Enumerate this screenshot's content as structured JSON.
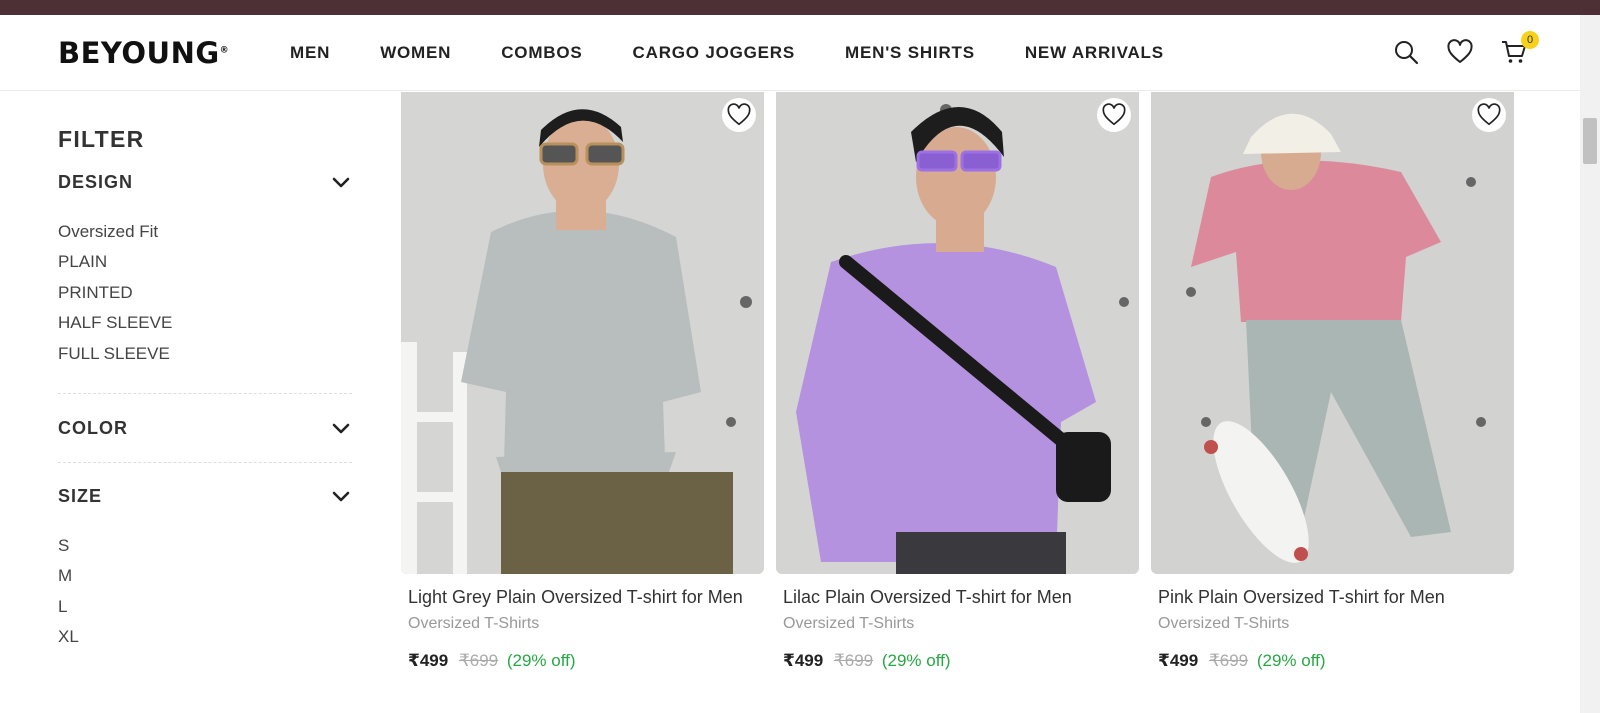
{
  "brand": {
    "logo": "BEYOUNG",
    "mark": "®",
    "topbar_color": "#4d2f36"
  },
  "nav": [
    "MEN",
    "WOMEN",
    "COMBOS",
    "CARGO JOGGERS",
    "MEN'S SHIRTS",
    "NEW ARRIVALS"
  ],
  "header_icons": {
    "search": "search-icon",
    "wishlist": "heart-icon",
    "cart": "cart-icon",
    "cart_count": "0"
  },
  "sidebar": {
    "title": "FILTER",
    "design": {
      "label": "DESIGN",
      "options": [
        "Oversized Fit",
        "PLAIN",
        "PRINTED",
        "HALF SLEEVE",
        "FULL SLEEVE"
      ]
    },
    "color": {
      "label": "COLOR"
    },
    "size": {
      "label": "SIZE",
      "options": [
        "S",
        "M",
        "L",
        "XL"
      ]
    }
  },
  "products": [
    {
      "name": "Light Grey Plain Oversized T-shirt for Men",
      "category": "Oversized T-Shirts",
      "price": "₹499",
      "mrp": "₹699",
      "discount": "(29% off)",
      "shirt_color": "#b8bdbd",
      "pants_color": "#6b6245"
    },
    {
      "name": "Lilac Plain Oversized T-shirt for Men",
      "category": "Oversized T-Shirts",
      "price": "₹499",
      "mrp": "₹699",
      "discount": "(29% off)",
      "shirt_color": "#b592e0",
      "pants_color": "#3a3a3e"
    },
    {
      "name": "Pink Plain Oversized T-shirt for Men",
      "category": "Oversized T-Shirts",
      "price": "₹499",
      "mrp": "₹699",
      "discount": "(29% off)",
      "shirt_color": "#dc8a9b",
      "pants_color": "#aab6b3"
    }
  ],
  "colors": {
    "accent_badge": "#f7d21c",
    "discount": "#27a844"
  }
}
